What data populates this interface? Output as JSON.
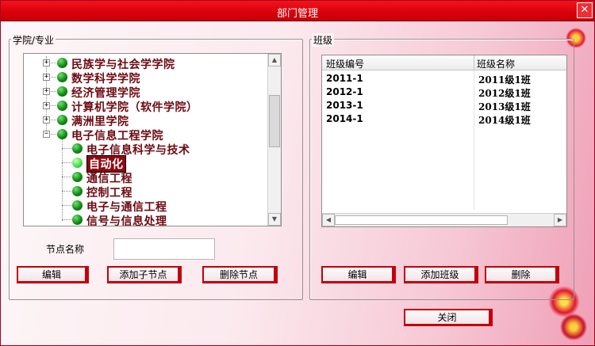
{
  "window": {
    "title": "部门管理",
    "close_glyph": "✕"
  },
  "left_group": {
    "label": "学院/专业",
    "tree": [
      {
        "label": "民族学与社会学学院",
        "level": 0,
        "expander": "+"
      },
      {
        "label": "数学科学学院",
        "level": 0,
        "expander": "+"
      },
      {
        "label": "经济管理学院",
        "level": 0,
        "expander": "+"
      },
      {
        "label": "计算机学院（软件学院）",
        "level": 0,
        "expander": "+"
      },
      {
        "label": "满洲里学院",
        "level": 0,
        "expander": "+"
      },
      {
        "label": "电子信息工程学院",
        "level": 0,
        "expander": "−"
      },
      {
        "label": "电子信息科学与技术",
        "level": 1
      },
      {
        "label": "自动化",
        "level": 1,
        "selected": true
      },
      {
        "label": "通信工程",
        "level": 1
      },
      {
        "label": "控制工程",
        "level": 1
      },
      {
        "label": "电子与通信工程",
        "level": 1
      },
      {
        "label": "信号与信息处理",
        "level": 1
      }
    ],
    "node_name_label": "节点名称",
    "node_name_value": "",
    "buttons": {
      "edit": "编辑",
      "add_child": "添加子节点",
      "delete": "删除节点"
    }
  },
  "right_group": {
    "label": "班级",
    "columns": [
      "班级编号",
      "班级名称"
    ],
    "rows": [
      [
        "2011-1",
        "2011级1班"
      ],
      [
        "2012-1",
        "2012级1班"
      ],
      [
        "2013-1",
        "2013级1班"
      ],
      [
        "2014-1",
        "2014级1班"
      ]
    ],
    "buttons": {
      "edit": "编辑",
      "add_class": "添加班级",
      "delete": "删除"
    }
  },
  "footer": {
    "close": "关闭"
  },
  "colors": {
    "title_bar": "#d7000a",
    "button_border": "#c2000c",
    "tree_text": "#6c0a12"
  }
}
